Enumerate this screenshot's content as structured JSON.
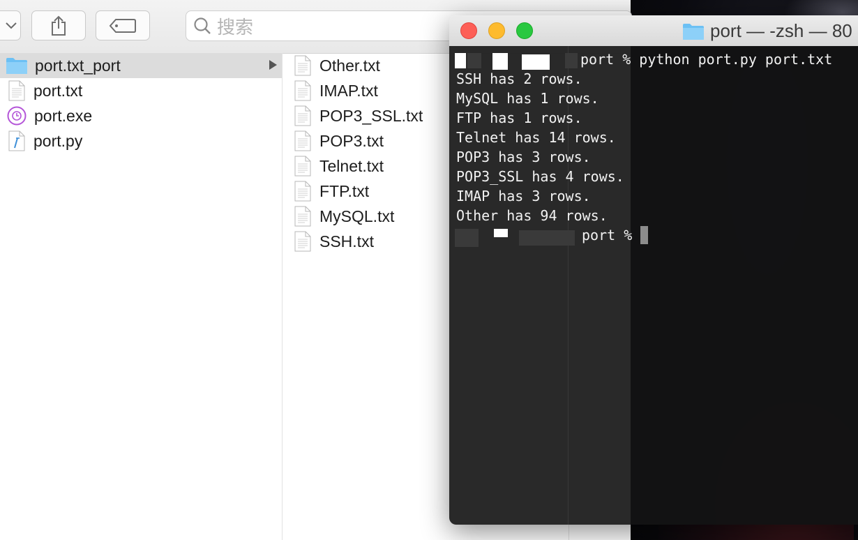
{
  "finder": {
    "search_placeholder": "搜索",
    "column1": [
      {
        "name": "port.txt_port",
        "kind": "folder",
        "selected": true
      },
      {
        "name": "port.txt",
        "kind": "text"
      },
      {
        "name": "port.exe",
        "kind": "exe"
      },
      {
        "name": "port.py",
        "kind": "python"
      }
    ],
    "column2": [
      {
        "name": "Other.txt"
      },
      {
        "name": "IMAP.txt"
      },
      {
        "name": "POP3_SSL.txt"
      },
      {
        "name": "POP3.txt"
      },
      {
        "name": "Telnet.txt"
      },
      {
        "name": "FTP.txt"
      },
      {
        "name": "MySQL.txt"
      },
      {
        "name": "SSH.txt"
      }
    ]
  },
  "terminal": {
    "title": "port — -zsh — 80",
    "command_line": "port % python port.py port.txt",
    "output": [
      "SSH has 2 rows.",
      "MySQL has 1 rows.",
      "FTP has 1 rows.",
      "Telnet has 14 rows.",
      "POP3 has 3 rows.",
      "POP3_SSL has 4 rows.",
      "IMAP has 3 rows.",
      "Other has 94 rows."
    ],
    "prompt": "port %"
  },
  "colors": {
    "folder_blue": "#6cc0f4",
    "close_red": "#fd5f57",
    "minimize_yellow": "#febb2e",
    "zoom_green": "#29c840",
    "exe_purple": "#b455d8",
    "python_blue": "#3d8fd8"
  }
}
